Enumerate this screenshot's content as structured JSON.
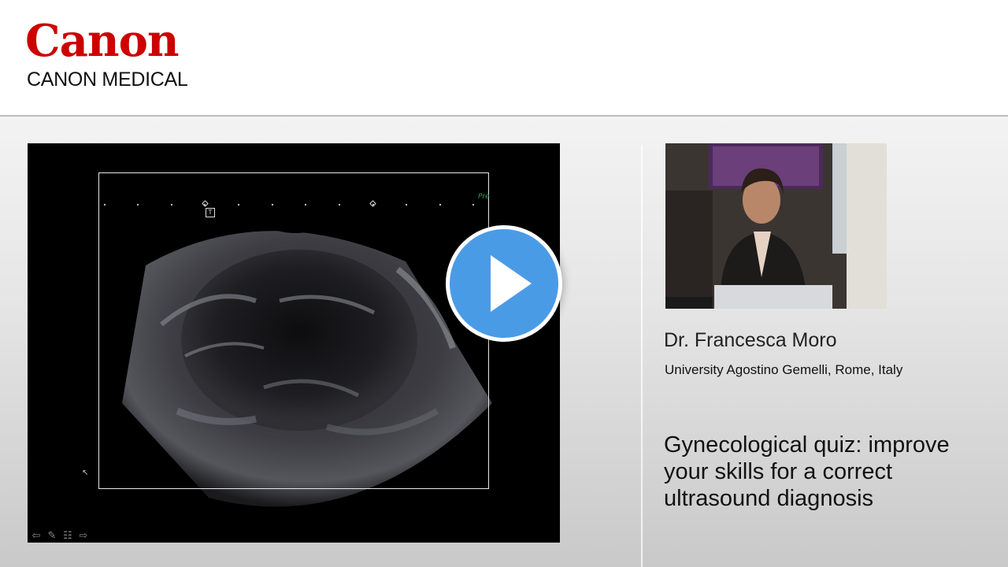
{
  "header": {
    "logo_text": "Canon",
    "subtitle": "CANON MEDICAL"
  },
  "video": {
    "overlay_label": "Pre",
    "marker_label": "T",
    "play_icon": "play-icon",
    "toolbar_icons": [
      "arrow-left-icon",
      "pencil-icon",
      "notes-icon",
      "arrow-right-icon"
    ]
  },
  "speaker": {
    "name": "Dr. Francesca Moro",
    "affiliation": "University Agostino Gemelli, Rome, Italy"
  },
  "talk": {
    "title": "Gynecological quiz: improve your skills for a correct ultrasound diagnosis"
  },
  "colors": {
    "brand_red": "#cc0000",
    "play_blue": "#4a9be6"
  }
}
